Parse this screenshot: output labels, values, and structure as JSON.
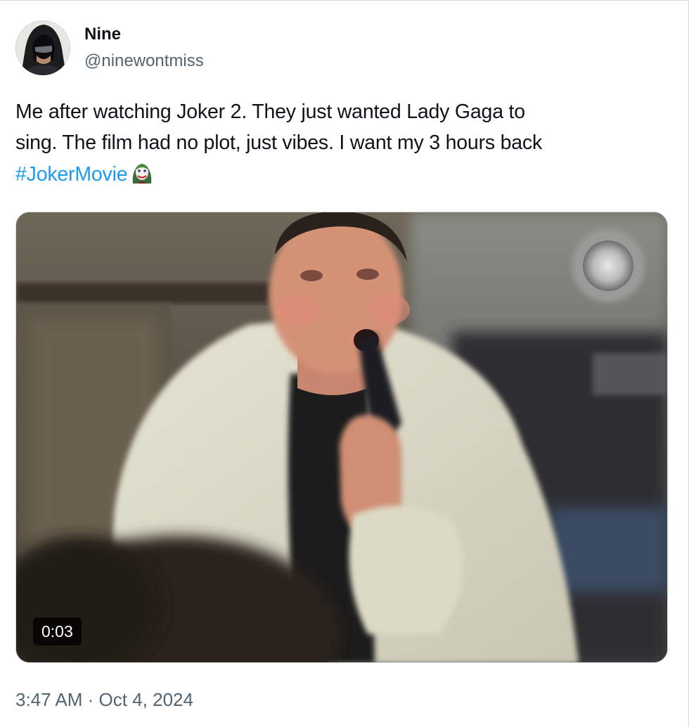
{
  "author": {
    "display_name": "Nine",
    "handle": "@ninewontmiss",
    "avatar_icon": "hooded-figure-avatar"
  },
  "tweet": {
    "text_line1": "Me after watching Joker 2. They just wanted Lady Gaga to",
    "text_line2": "sing. The film had no plot, just vibes. I want my 3 hours back",
    "hashtag": "#JokerMovie",
    "emoji_icon": "joker-face-emoji"
  },
  "media": {
    "type": "video",
    "duration": "0:03"
  },
  "meta": {
    "time": "3:47 AM",
    "separator": "·",
    "date": "Oct 4, 2024"
  },
  "colors": {
    "link": "#1d9bf0",
    "secondary_text": "#536471",
    "primary_text": "#0f1419",
    "border": "#cfd9de"
  }
}
